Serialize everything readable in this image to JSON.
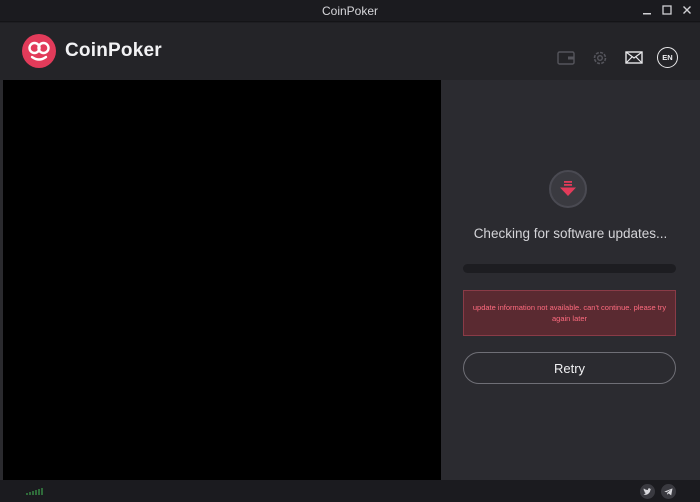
{
  "window": {
    "title": "CoinPoker"
  },
  "header": {
    "brand_name": "CoinPoker",
    "language": "EN",
    "icons": [
      "wallet-icon",
      "gear-icon",
      "mail-icon"
    ]
  },
  "update": {
    "status": "Checking for software updates...",
    "progress_percent": 0,
    "error_message": "update information not available. can't continue. please try again later",
    "retry_label": "Retry"
  },
  "colors": {
    "accent": "#e23b5a",
    "error_bg": "#5a2a31",
    "error_text": "#ff6b7f",
    "panel_bg": "#2b2b30"
  },
  "footer": {
    "social": [
      "twitter-icon",
      "telegram-icon"
    ]
  }
}
